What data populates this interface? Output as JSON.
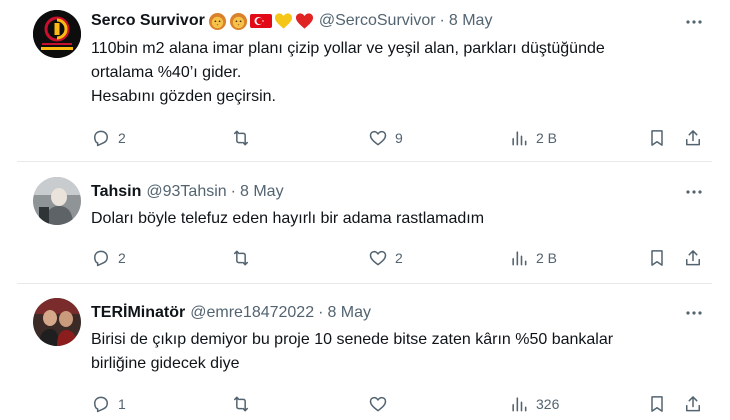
{
  "colors": {
    "text": "#0f1419",
    "muted": "#536471",
    "divider": "#e7e9ea",
    "heart_red": "#e02424",
    "heart_yellow": "#f5c518",
    "flag_red": "#e30a17"
  },
  "tweets": [
    {
      "name": "Serco Survivor",
      "name_emojis": [
        "lion-face",
        "lion-face",
        "turkey-flag",
        "yellow-heart",
        "red-heart"
      ],
      "handle": "@SercoSurvivor",
      "dot": "·",
      "date": "8 May",
      "avatar": "Galatasaray crest logo",
      "lines": [
        "110bin m2 alana imar planı çizip yollar ve yeşil alan, parkları düştüğünde",
        "ortalama %40’ı gider.",
        "Hesabını gözden geçirsin."
      ],
      "replies": "2",
      "retweets": "",
      "likes": "9",
      "views": "2 B"
    },
    {
      "name": "Tahsin",
      "handle": "@93Tahsin",
      "dot": "·",
      "date": "8 May",
      "avatar": "user photo",
      "lines": [
        "Doları böyle telefuz eden hayırlı bir adama rastlamadım"
      ],
      "replies": "2",
      "retweets": "",
      "likes": "2",
      "views": "2 B"
    },
    {
      "name": "TERİMinatör",
      "handle": "@emre18472022",
      "dot": "·",
      "date": "8 May",
      "avatar": "user photo",
      "lines": [
        "Birisi de çıkıp demiyor bu proje 10 senede bitse zaten kârın %50 bankalar",
        "birliğine gidecek diye"
      ],
      "replies": "1",
      "retweets": "",
      "likes": "",
      "views": "326"
    }
  ]
}
